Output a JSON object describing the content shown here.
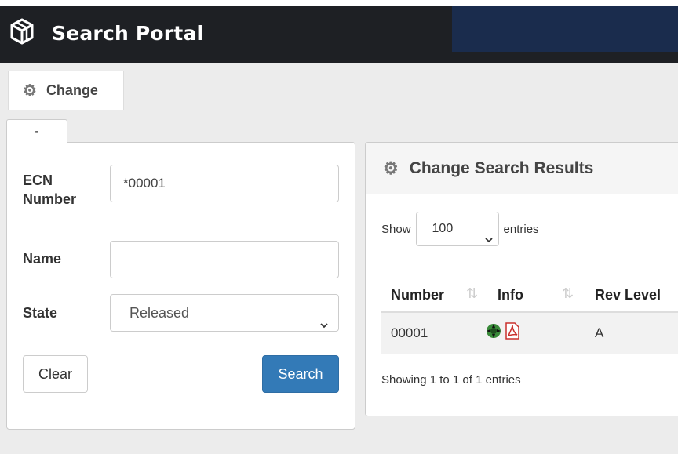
{
  "header": {
    "title": "Search Portal",
    "logo_icon": "cube-icon",
    "bg_color": "#1e2024",
    "right_block_color": "#1a2c4d"
  },
  "main_tab": {
    "label": "Change",
    "icon": "gear-icon"
  },
  "mini_tab": {
    "label": "-"
  },
  "search_form": {
    "ecn_label_line1": "ECN",
    "ecn_label_line2": "Number",
    "ecn_value": "*00001",
    "name_label": "Name",
    "name_value": "",
    "state_label": "State",
    "state_value": "Released",
    "clear_label": "Clear",
    "search_label": "Search",
    "primary_color": "#337ab7"
  },
  "results": {
    "heading": "Change Search Results",
    "show_label": "Show",
    "page_size": "100",
    "entries_label": "entries",
    "columns": [
      "Number",
      "Info",
      "Rev Level"
    ],
    "rows": [
      {
        "number": "00001",
        "info_icons": [
          "object-icon",
          "pdf-icon"
        ],
        "rev_level": "A"
      }
    ],
    "footer": "Showing 1 to 1 of 1 entries"
  }
}
